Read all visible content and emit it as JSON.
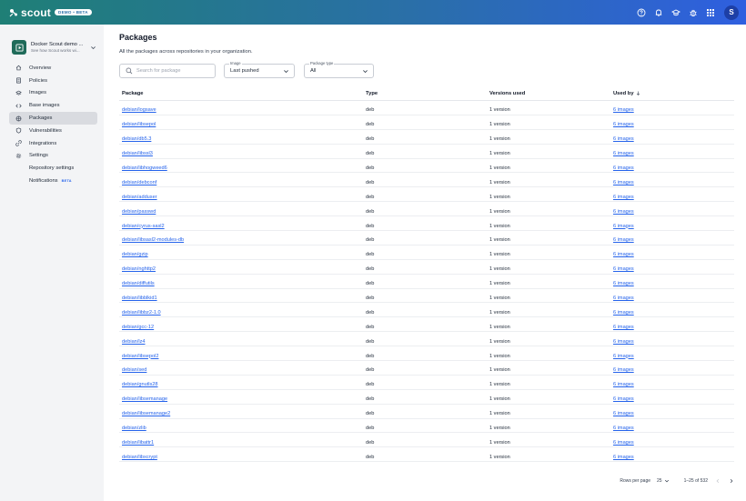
{
  "app": {
    "brand": "scout",
    "badge": "DEMO • BETA",
    "avatar_initial": "S",
    "colors": {
      "accent": "#2563eb",
      "active_nav": "#d9dbe0",
      "org_logo": "#1f6b5a"
    }
  },
  "topbar": {
    "icons": [
      "help-icon",
      "bell-icon",
      "graduation-cap-icon",
      "bug-icon",
      "apps-grid-icon"
    ]
  },
  "sidebar": {
    "org_name": "Docker Scout demo ...",
    "org_sub": "See how Scout works wi...",
    "items": [
      {
        "label": "Overview",
        "icon": "home-icon",
        "active": false
      },
      {
        "label": "Policies",
        "icon": "policy-icon",
        "active": false
      },
      {
        "label": "Images",
        "icon": "layers-icon",
        "active": false
      },
      {
        "label": "Base images",
        "icon": "code-icon",
        "active": false
      },
      {
        "label": "Packages",
        "icon": "package-icon",
        "active": true
      },
      {
        "label": "Vulnerabilities",
        "icon": "shield-icon",
        "active": false
      },
      {
        "label": "Integrations",
        "icon": "integration-icon",
        "active": false
      },
      {
        "label": "Settings",
        "icon": "gear-icon",
        "active": false
      }
    ],
    "sub_items": [
      {
        "label": "Repository settings"
      },
      {
        "label": "Notifications",
        "badge": "BETA"
      }
    ]
  },
  "main": {
    "title": "Packages",
    "description": "All the packages across repositories in your organization.",
    "search_placeholder": "Search for package",
    "image_filter": {
      "legend": "Image",
      "value": "Last pushed"
    },
    "type_filter": {
      "legend": "Package type",
      "value": "All"
    }
  },
  "table": {
    "headers": {
      "package": "Package",
      "type": "Type",
      "versions": "Versions used",
      "used_by": "Used by"
    },
    "rows": [
      {
        "package": "debian/logsave",
        "type": "deb",
        "versions": "1 version",
        "used_by": "6 images"
      },
      {
        "package": "debian/libsepol",
        "type": "deb",
        "versions": "1 version",
        "used_by": "6 images"
      },
      {
        "package": "debian/db5.3",
        "type": "deb",
        "versions": "1 version",
        "used_by": "6 images"
      },
      {
        "package": "debian/libssl3",
        "type": "deb",
        "versions": "1 version",
        "used_by": "6 images"
      },
      {
        "package": "debian/libhogweed6",
        "type": "deb",
        "versions": "1 version",
        "used_by": "6 images"
      },
      {
        "package": "debian/debconf",
        "type": "deb",
        "versions": "1 version",
        "used_by": "6 images"
      },
      {
        "package": "debian/adduser",
        "type": "deb",
        "versions": "1 version",
        "used_by": "6 images"
      },
      {
        "package": "debian/passwd",
        "type": "deb",
        "versions": "1 version",
        "used_by": "6 images"
      },
      {
        "package": "debian/cyrus-sasl2",
        "type": "deb",
        "versions": "1 version",
        "used_by": "6 images"
      },
      {
        "package": "debian/libsasl2-modules-db",
        "type": "deb",
        "versions": "1 version",
        "used_by": "6 images"
      },
      {
        "package": "debian/gzip",
        "type": "deb",
        "versions": "1 version",
        "used_by": "6 images"
      },
      {
        "package": "debian/nghttp2",
        "type": "deb",
        "versions": "1 version",
        "used_by": "6 images"
      },
      {
        "package": "debian/diffutils",
        "type": "deb",
        "versions": "1 version",
        "used_by": "6 images"
      },
      {
        "package": "debian/libblkid1",
        "type": "deb",
        "versions": "1 version",
        "used_by": "6 images"
      },
      {
        "package": "debian/libbz2-1.0",
        "type": "deb",
        "versions": "1 version",
        "used_by": "6 images"
      },
      {
        "package": "debian/gcc-12",
        "type": "deb",
        "versions": "1 version",
        "used_by": "6 images"
      },
      {
        "package": "debian/lz4",
        "type": "deb",
        "versions": "1 version",
        "used_by": "6 images"
      },
      {
        "package": "debian/libsepol2",
        "type": "deb",
        "versions": "1 version",
        "used_by": "6 images"
      },
      {
        "package": "debian/sed",
        "type": "deb",
        "versions": "1 version",
        "used_by": "6 images"
      },
      {
        "package": "debian/gnutls28",
        "type": "deb",
        "versions": "1 version",
        "used_by": "6 images"
      },
      {
        "package": "debian/libsemanage",
        "type": "deb",
        "versions": "1 version",
        "used_by": "6 images"
      },
      {
        "package": "debian/libsemanage2",
        "type": "deb",
        "versions": "1 version",
        "used_by": "6 images"
      },
      {
        "package": "debian/zlib",
        "type": "deb",
        "versions": "1 version",
        "used_by": "6 images"
      },
      {
        "package": "debian/libattr1",
        "type": "deb",
        "versions": "1 version",
        "used_by": "6 images"
      },
      {
        "package": "debian/libxcrypt",
        "type": "deb",
        "versions": "1 version",
        "used_by": "6 images"
      }
    ]
  },
  "pagination": {
    "rows_label": "Rows per page",
    "rows_value": "25",
    "range": "1–25 of 532"
  }
}
